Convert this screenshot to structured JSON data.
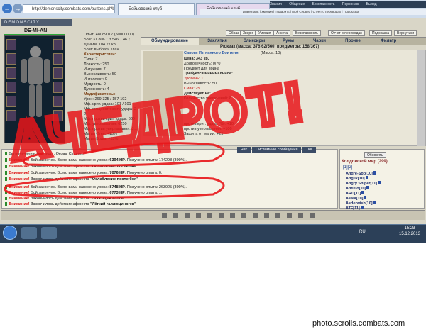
{
  "browser": {
    "address": "http://demonscity.combats.com/buttons.pl?battle=",
    "tabs": [
      "Бойцовский клуб",
      "Бойцовский клуб"
    ],
    "top_menu": [
      "Знания",
      "Общение",
      "Безопасность",
      "Персонаж",
      "Выход"
    ],
    "link_bar": "Инвентарь | Умения | Подарить | Мой Сервер | Отчёт о переводах | Подсказка"
  },
  "game": {
    "brand": "DEMONSCITY",
    "character_name": "DE-MI-AN",
    "header_buttons": [
      "Образ",
      "Звери",
      "Умения",
      "Анкета",
      "Безопасность",
      "Отчет о переводах",
      "Подсказка",
      "Вернуться"
    ],
    "stats": {
      "lines": [
        "Опыт: 48089017 (50000000)",
        "Бои: 31 806 ↑ 3 546 ↓ 46 ↑",
        "Деньги: 104.27 кр.",
        "Бриг: выбрать клан"
      ],
      "characteristics_header": "Характеристики:",
      "characteristics": [
        "Сила: 7",
        "Ловкость: 250",
        "Интуиция: 7",
        "Выносливость: 50",
        "Интеллект: 0",
        "Мудрость: 0",
        "Духовность: 4"
      ],
      "modifiers_header": "Модификаторы:",
      "modifiers": [
        "Урон: 269-325 / 157-192",
        "Мф. крит. удара: 101 / 101",
        "Мф. мощности крит. удара: 2 / 2",
        "Мф. против крит. удара: 630",
        "Мф. увертывания: 6250",
        "Мф. против увертывания: 3..."
      ],
      "footer": [
        "Магия Огня: +13%",
        "Магия Воды: +13%"
      ]
    },
    "tabs": [
      "Обмундирование",
      "Заклятия",
      "Эликсиры",
      "Руны",
      "Чарки",
      "Прочее",
      "Фильтр"
    ],
    "active_tab": "Обмундирование",
    "backpack": "Рюкзак (масса: 376.62/560, предметов: 158/367)",
    "shop_item": {
      "name": "Сапоги Изгнанного Воителя",
      "mass": "(Масса: 10)",
      "price": "Цена: 343 кр.",
      "durability": "Долговечность: 0/70",
      "note": "Предмет для воина",
      "requires_header": "Требуется минимальное:",
      "requires": [
        "Уровень: 11",
        "Выносливость: 50",
        "Сила: 25"
      ],
      "acts_header": "Действует на:",
      "upgrades": "Количество увеличений: 8",
      "effects": [
        "против крит. удара (%): +10",
        "против увертывания: +100",
        "Защита от магии: +25"
      ]
    },
    "chat": {
      "tabs": [
        "Чат",
        "Системные сообщения",
        "Лог"
      ],
      "messages": [
        {
          "warn": "",
          "text": "Вы получили в бою под... Оковы Сущно..."
        },
        {
          "warn": "Внимание!",
          "text": "Бой закончен. Всего вами нанесено урона: ",
          "bold": "6394 HP",
          "tail": ". Получено опыта: 174298 (300%)."
        },
        {
          "warn": "Внимание!",
          "text": "Закончилось действие эффекта ",
          "bold": "\"Ослабление после боя\"",
          "tail": ""
        },
        {
          "warn": "Внимание!",
          "text": "Бой закончен. Всего вами нанесено урона: ",
          "bold": "7076 HP",
          "tail": ". Получено опыта: 0."
        },
        {
          "warn": "Внимание!",
          "text": "Закончилось действие эффекта ",
          "bold": "\"Ослабление после боя\"",
          "tail": ""
        },
        {
          "warn": "Внимание!",
          "text": "Бой закончен. Всего вами нанесено урона: ",
          "bold": "8748 HP",
          "tail": ". Получено опыта: 263925 (300%)."
        },
        {
          "warn": "Внимание!",
          "text": "Бой закончен. Всего вами нанесено урона: ",
          "bold": "6773 HP",
          "tail": ". Получено опыта: ..."
        },
        {
          "warn": "Внимание!",
          "text": "Закончилось действие эффекта ",
          "bold": "\"Эссенция Хаоса\"",
          "tail": ""
        },
        {
          "warn": "Внимание!",
          "text": "Закончилось действие эффекта ",
          "bold": "\"Лёгкий галлюциноген\"",
          "tail": ""
        }
      ]
    },
    "online": {
      "refresh": "Обновить",
      "title": "Колдовской мир (299)",
      "pages": "[1][2]",
      "players": [
        "Andre-Spb[10]",
        "Anglik[10]",
        "Angry Sniper[11]",
        "Antielo[10]",
        "ARD[11]",
        "Asala[10]",
        "Asderwish[10]",
        "ATF[11]"
      ]
    }
  },
  "scrawl_text": "АЧЕДРОТ!",
  "taskbar": {
    "lang": "RU",
    "time": "15:23",
    "date": "15.12.2013"
  },
  "credit": "photo.scrolls.combats.com"
}
